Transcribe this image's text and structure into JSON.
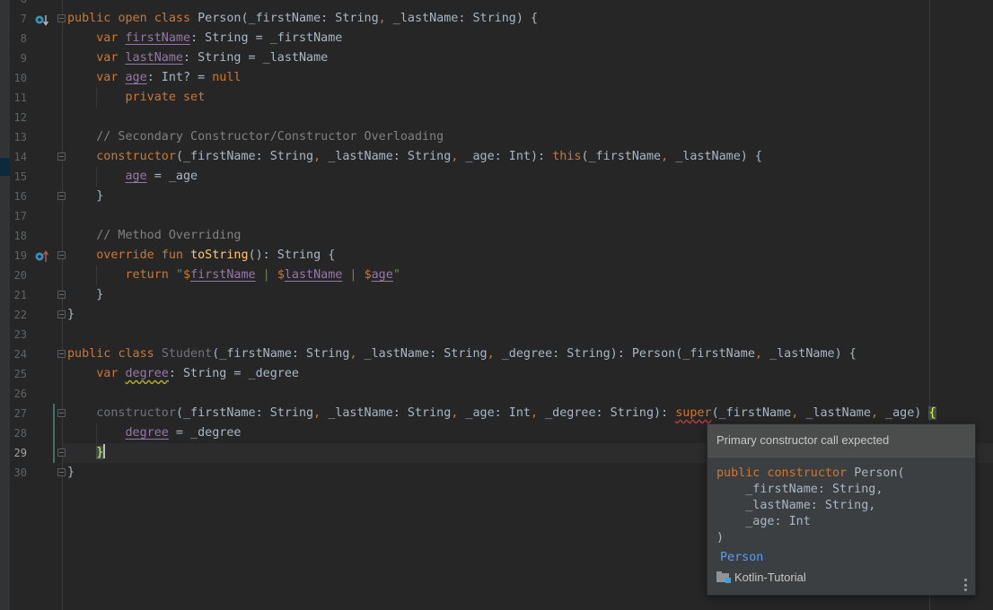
{
  "editor": {
    "current_line": 29,
    "lines": [
      {
        "n": "7",
        "parts": [
          [
            "kw",
            "public"
          ],
          [
            "t",
            " "
          ],
          [
            "kw",
            "open"
          ],
          [
            "t",
            " "
          ],
          [
            "kw",
            "class"
          ],
          [
            "t",
            " Person(_firstName: String"
          ],
          [
            "kw",
            ","
          ],
          [
            "t",
            " _lastName: String) {"
          ]
        ]
      },
      {
        "n": "8",
        "parts": [
          [
            "t",
            "    "
          ],
          [
            "kw",
            "var"
          ],
          [
            "t",
            " "
          ],
          [
            "prop",
            "firstName"
          ],
          [
            "t",
            ": String = _firstName"
          ]
        ]
      },
      {
        "n": "9",
        "parts": [
          [
            "t",
            "    "
          ],
          [
            "kw",
            "var"
          ],
          [
            "t",
            " "
          ],
          [
            "prop",
            "lastName"
          ],
          [
            "t",
            ": String = _lastName"
          ]
        ]
      },
      {
        "n": "10",
        "parts": [
          [
            "t",
            "    "
          ],
          [
            "kw",
            "var"
          ],
          [
            "t",
            " "
          ],
          [
            "prop",
            "age"
          ],
          [
            "t",
            ": Int? = "
          ],
          [
            "kw",
            "null"
          ]
        ]
      },
      {
        "n": "11",
        "parts": [
          [
            "t",
            "        "
          ],
          [
            "kw",
            "private set"
          ]
        ]
      },
      {
        "n": "12",
        "parts": []
      },
      {
        "n": "13",
        "parts": [
          [
            "t",
            "    "
          ],
          [
            "cmt",
            "// Secondary Constructor/Constructor Overloading"
          ]
        ]
      },
      {
        "n": "14",
        "parts": [
          [
            "t",
            "    "
          ],
          [
            "kw",
            "constructor"
          ],
          [
            "t",
            "(_firstName: String"
          ],
          [
            "kw",
            ","
          ],
          [
            "t",
            " _lastName: String"
          ],
          [
            "kw",
            ","
          ],
          [
            "t",
            " _age: Int): "
          ],
          [
            "kw",
            "this"
          ],
          [
            "t",
            "(_firstName"
          ],
          [
            "kw",
            ","
          ],
          [
            "t",
            " _lastName) {"
          ]
        ]
      },
      {
        "n": "15",
        "parts": [
          [
            "t",
            "        "
          ],
          [
            "prop",
            "age"
          ],
          [
            "t",
            " = _age"
          ]
        ]
      },
      {
        "n": "16",
        "parts": [
          [
            "t",
            "    }"
          ]
        ]
      },
      {
        "n": "17",
        "parts": []
      },
      {
        "n": "18",
        "parts": [
          [
            "t",
            "    "
          ],
          [
            "cmt",
            "// Method Overriding"
          ]
        ]
      },
      {
        "n": "19",
        "parts": [
          [
            "t",
            "    "
          ],
          [
            "kw",
            "override fun"
          ],
          [
            "t",
            " "
          ],
          [
            "fn",
            "toString"
          ],
          [
            "t",
            "(): String {"
          ]
        ]
      },
      {
        "n": "20",
        "parts": [
          [
            "t",
            "        "
          ],
          [
            "kw",
            "return"
          ],
          [
            "t",
            " "
          ],
          [
            "str",
            "\""
          ],
          [
            "tpl",
            "$"
          ],
          [
            "prop",
            "firstName"
          ],
          [
            "str",
            " | "
          ],
          [
            "tpl",
            "$"
          ],
          [
            "prop",
            "lastName"
          ],
          [
            "str",
            " | "
          ],
          [
            "tpl",
            "$"
          ],
          [
            "prop",
            "age"
          ],
          [
            "str",
            "\""
          ]
        ]
      },
      {
        "n": "21",
        "parts": [
          [
            "t",
            "    }"
          ]
        ]
      },
      {
        "n": "22",
        "parts": [
          [
            "t",
            "}"
          ]
        ]
      },
      {
        "n": "23",
        "parts": []
      },
      {
        "n": "24",
        "parts": [
          [
            "kw",
            "public"
          ],
          [
            "t",
            " "
          ],
          [
            "kw",
            "class"
          ],
          [
            "t",
            " "
          ],
          [
            "unused",
            "Student"
          ],
          [
            "t",
            "(_firstName: String"
          ],
          [
            "kw",
            ","
          ],
          [
            "t",
            " _lastName: String"
          ],
          [
            "kw",
            ","
          ],
          [
            "t",
            " _degree: String): Person(_firstName"
          ],
          [
            "kw",
            ","
          ],
          [
            "t",
            " _lastName) {"
          ]
        ]
      },
      {
        "n": "25",
        "parts": [
          [
            "t",
            "    "
          ],
          [
            "kw",
            "var"
          ],
          [
            "t",
            " "
          ],
          [
            "propwarn",
            "degree"
          ],
          [
            "t",
            ": String = _degree"
          ]
        ]
      },
      {
        "n": "26",
        "parts": []
      },
      {
        "n": "27",
        "parts": [
          [
            "t",
            "    "
          ],
          [
            "unused",
            "constructor"
          ],
          [
            "t",
            "(_firstName: String"
          ],
          [
            "kw",
            ","
          ],
          [
            "t",
            " _lastName: String"
          ],
          [
            "kw",
            ","
          ],
          [
            "t",
            " _age: Int"
          ],
          [
            "kw",
            ","
          ],
          [
            "t",
            " _degree: String): "
          ],
          [
            "kwerr",
            "super"
          ],
          [
            "t",
            "(_firstName"
          ],
          [
            "kw",
            ","
          ],
          [
            "t",
            " _lastName"
          ],
          [
            "kw",
            ","
          ],
          [
            "t",
            " _age) "
          ],
          [
            "brace",
            "{"
          ]
        ]
      },
      {
        "n": "28",
        "parts": [
          [
            "t",
            "        "
          ],
          [
            "prop",
            "degree"
          ],
          [
            "t",
            " = _degree"
          ]
        ]
      },
      {
        "n": "29",
        "parts": [
          [
            "t",
            "    "
          ],
          [
            "brace",
            "}"
          ]
        ]
      },
      {
        "n": "30",
        "parts": [
          [
            "t",
            "}"
          ]
        ]
      }
    ]
  },
  "popup": {
    "title": "Primary constructor call expected",
    "signature_keyword": "public constructor",
    "signature_name": "Person(",
    "params": [
      "    _firstName: String,",
      "    _lastName: String,",
      "    _age: Int"
    ],
    "close_paren": ")",
    "class_link": "Person",
    "module": "Kotlin-Tutorial"
  }
}
